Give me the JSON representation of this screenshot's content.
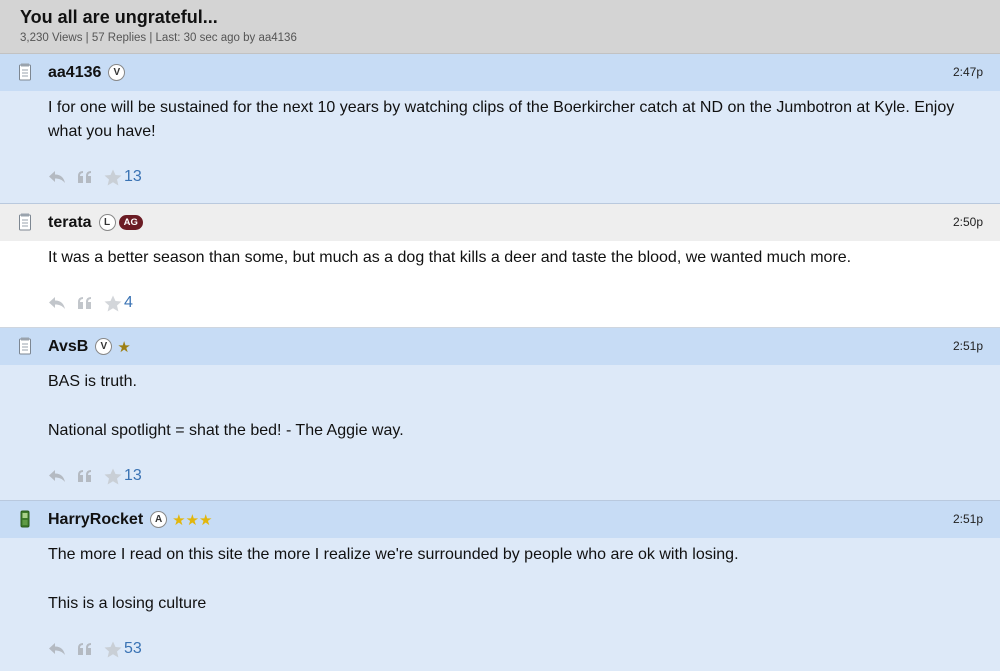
{
  "thread": {
    "title": "You all are ungrateful...",
    "meta": "3,230 Views | 57 Replies | Last: 30 sec ago by aa4136"
  },
  "colors": {
    "post_bg_blue": "#dde9f8",
    "post_head_blue": "#c7dcf5",
    "post_head_gray": "#eeeeee",
    "ag_badge": "#6b1c24",
    "like_count": "#3a73b4"
  },
  "posts": [
    {
      "username": "aa4136",
      "badge": "V",
      "time": "2:47p",
      "body": [
        "I for one will be sustained for the next 10 years by watching clips of the Boerkircher catch at ND on the Jumbotron at Kyle. Enjoy what you have!"
      ],
      "likes": "13",
      "device_icon": "notepad-icon"
    },
    {
      "username": "terata",
      "badge": "L",
      "badge_ag": "AG",
      "time": "2:50p",
      "body": [
        "It was a better season than some, but much as a dog that kills a deer and taste the blood, we wanted much more."
      ],
      "likes": "4",
      "device_icon": "notepad-icon"
    },
    {
      "username": "AvsB",
      "badge": "V",
      "stars": "★",
      "time": "2:51p",
      "body": [
        "BAS is truth.",
        "National spotlight = shat the bed! - The Aggie way."
      ],
      "likes": "13",
      "device_icon": "notepad-icon"
    },
    {
      "username": "HarryRocket",
      "badge": "A",
      "stars": "★★★",
      "time": "2:51p",
      "body": [
        "The more I read on this site the more I realize we're surrounded by people who are ok with losing.",
        "This is a losing culture"
      ],
      "likes": "53",
      "device_icon": "cellphone-icon"
    }
  ]
}
